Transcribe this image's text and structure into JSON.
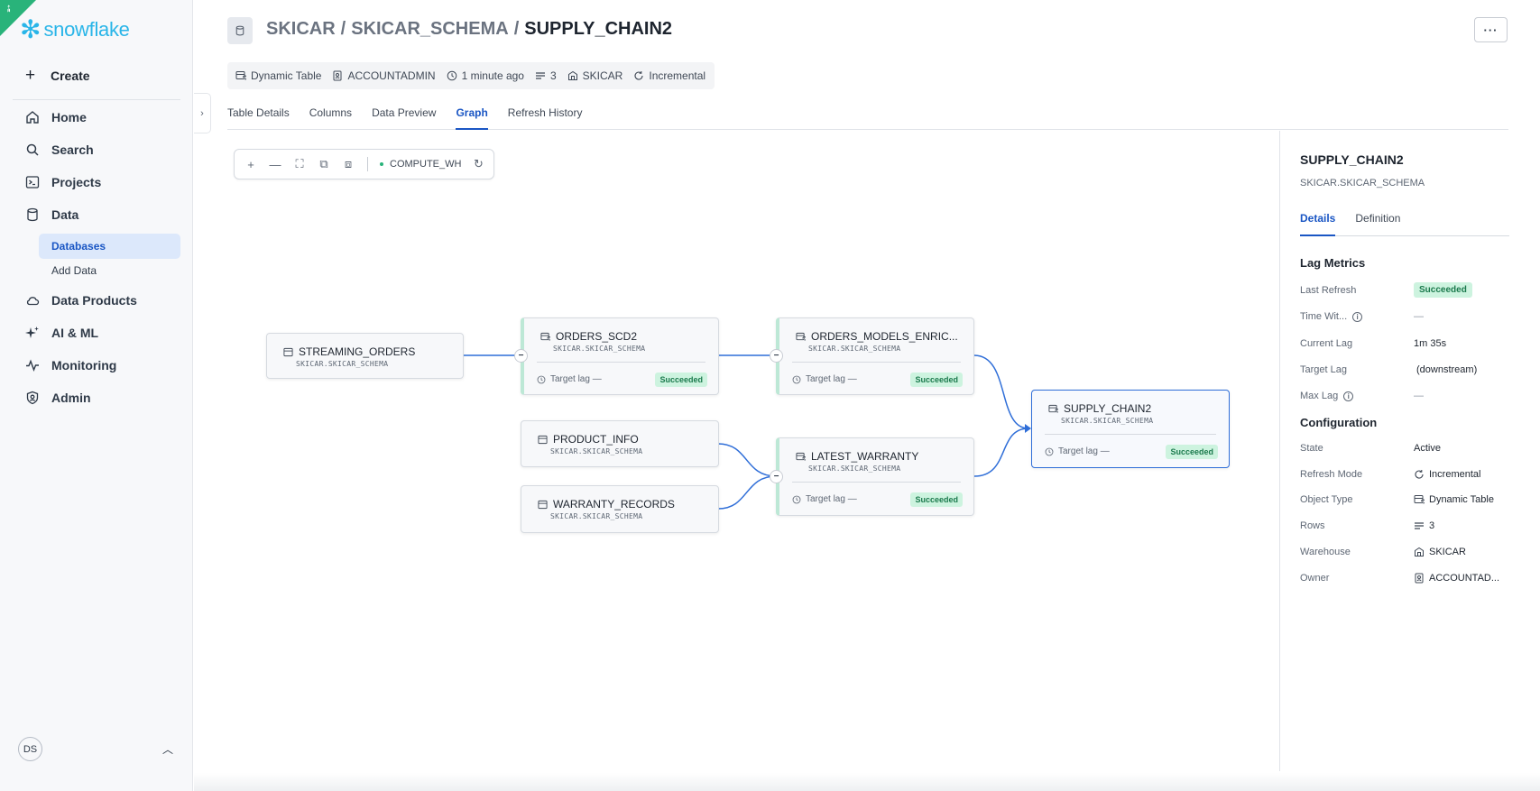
{
  "sidebar": {
    "brand": "snowflake",
    "create_label": "Create",
    "nav": {
      "home": "Home",
      "search": "Search",
      "projects": "Projects",
      "data": "Data",
      "databases": "Databases",
      "add_data": "Add Data",
      "data_products": "Data Products",
      "ai_ml": "AI & ML",
      "monitoring": "Monitoring",
      "admin": "Admin"
    },
    "user_initials": "DS"
  },
  "header": {
    "breadcrumb": [
      "SKICAR",
      "SKICAR_SCHEMA",
      "SUPPLY_CHAIN2"
    ],
    "separator": "/",
    "more_label": "···",
    "meta": {
      "type": "Dynamic Table",
      "owner": "ACCOUNTADMIN",
      "updated": "1 minute ago",
      "rows": "3",
      "warehouse": "SKICAR",
      "refresh_mode": "Incremental"
    },
    "tabs": [
      "Table Details",
      "Columns",
      "Data Preview",
      "Graph",
      "Refresh History"
    ],
    "active_tab": "Graph"
  },
  "graph": {
    "toolbar": {
      "warehouse": "COMPUTE_WH"
    },
    "nodes": {
      "streaming_orders": {
        "name": "STREAMING_ORDERS",
        "schema": "SKICAR.SKICAR_SCHEMA"
      },
      "orders_scd2": {
        "name": "ORDERS_SCD2",
        "schema": "SKICAR.SKICAR_SCHEMA",
        "lag": "Target lag —",
        "status": "Succeeded"
      },
      "orders_models": {
        "name": "ORDERS_MODELS_ENRIC...",
        "schema": "SKICAR.SKICAR_SCHEMA",
        "lag": "Target lag —",
        "status": "Succeeded"
      },
      "product_info": {
        "name": "PRODUCT_INFO",
        "schema": "SKICAR.SKICAR_SCHEMA"
      },
      "warranty_records": {
        "name": "WARRANTY_RECORDS",
        "schema": "SKICAR.SKICAR_SCHEMA"
      },
      "latest_warranty": {
        "name": "LATEST_WARRANTY",
        "schema": "SKICAR.SKICAR_SCHEMA",
        "lag": "Target lag —",
        "status": "Succeeded"
      },
      "supply_chain2": {
        "name": "SUPPLY_CHAIN2",
        "schema": "SKICAR.SKICAR_SCHEMA",
        "lag": "Target lag —",
        "status": "Succeeded"
      }
    }
  },
  "panel": {
    "title": "SUPPLY_CHAIN2",
    "subtitle": "SKICAR.SKICAR_SCHEMA",
    "tabs": [
      "Details",
      "Definition"
    ],
    "lag_metrics_title": "Lag Metrics",
    "lag": {
      "last_refresh_label": "Last Refresh",
      "last_refresh_value": "Succeeded",
      "time_within_label": "Time Wit...",
      "time_within_value": "—",
      "current_lag_label": "Current Lag",
      "current_lag_value": "1m 35s",
      "target_lag_label": "Target Lag",
      "target_lag_value": "(downstream)",
      "max_lag_label": "Max Lag",
      "max_lag_value": "—"
    },
    "config_title": "Configuration",
    "config": {
      "state_label": "State",
      "state_value": "Active",
      "refresh_mode_label": "Refresh Mode",
      "refresh_mode_value": "Incremental",
      "object_type_label": "Object Type",
      "object_type_value": "Dynamic Table",
      "rows_label": "Rows",
      "rows_value": "3",
      "warehouse_label": "Warehouse",
      "warehouse_value": "SKICAR",
      "owner_label": "Owner",
      "owner_value": "ACCOUNTAD..."
    }
  },
  "colors": {
    "brand": "#29b5e8",
    "accent": "#1a56c4",
    "success_bg": "#cdf3df",
    "success_text": "#1b7a4d",
    "edge": "#2f6ed8"
  }
}
